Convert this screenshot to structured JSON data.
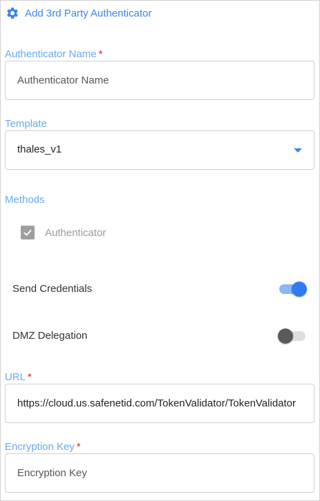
{
  "header": {
    "title": "Add 3rd Party Authenticator",
    "icon": "gear-icon"
  },
  "fields": {
    "authenticator_name": {
      "label": "Authenticator Name",
      "required_mark": "*",
      "value": "",
      "placeholder": "Authenticator Name"
    },
    "template": {
      "label": "Template",
      "selected": "thales_v1"
    },
    "url": {
      "label": "URL",
      "required_mark": "*",
      "value": "https://cloud.us.safenetid.com/TokenValidator/TokenValidator.asmx"
    },
    "encryption_key": {
      "label": "Encryption Key",
      "required_mark": "*",
      "value": "",
      "placeholder": "Encryption Key"
    }
  },
  "methods": {
    "label": "Methods",
    "authenticator": {
      "label": "Authenticator",
      "checked": true,
      "disabled": true
    }
  },
  "toggles": {
    "send_credentials": {
      "label": "Send Credentials",
      "on": true
    },
    "dmz_delegation": {
      "label": "DMZ Delegation",
      "on": false
    }
  },
  "colors": {
    "accent": "#3a86e8",
    "label": "#6aa8ef",
    "required": "#e02020"
  }
}
